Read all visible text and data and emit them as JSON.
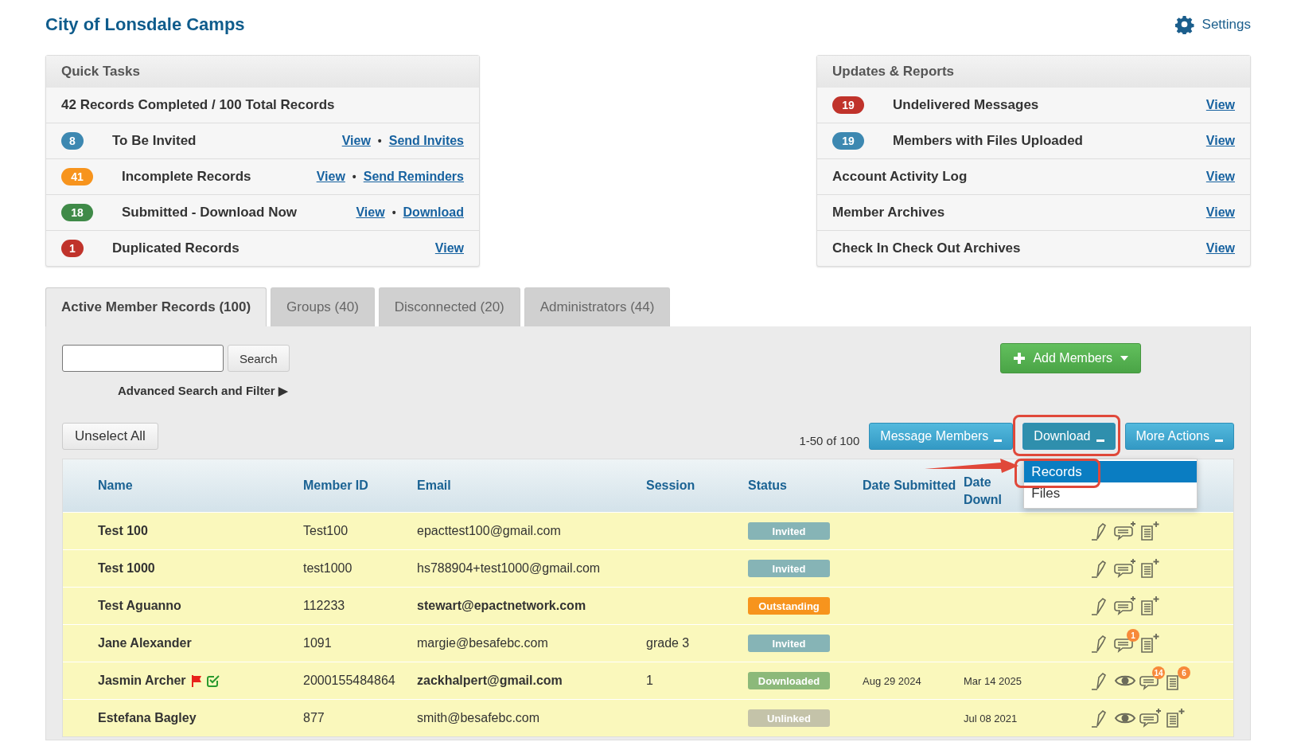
{
  "header": {
    "title": "City of Lonsdale Camps",
    "settings": "Settings"
  },
  "quick_tasks": {
    "title": "Quick Tasks",
    "separator": "•",
    "summary": "42 Records Completed / 100 Total Records",
    "rows": [
      {
        "count": "8",
        "color": "#3d88b1",
        "label": "To Be Invited",
        "links": [
          "View",
          "Send Invites"
        ]
      },
      {
        "count": "41",
        "color": "#f7941d",
        "label": "Incomplete Records",
        "links": [
          "View",
          "Send Reminders"
        ]
      },
      {
        "count": "18",
        "color": "#3f8a48",
        "label": "Submitted - Download Now",
        "links": [
          "View",
          "Download"
        ]
      },
      {
        "count": "1",
        "color": "#c0332b",
        "label": "Duplicated Records",
        "links": [
          "View"
        ]
      }
    ]
  },
  "updates": {
    "title": "Updates & Reports",
    "rows": [
      {
        "count": "19",
        "color": "#c0332b",
        "label": "Undelivered Messages",
        "link": "View"
      },
      {
        "count": "19",
        "color": "#3d88b1",
        "label": "Members with Files Uploaded",
        "link": "View"
      },
      {
        "label": "Account Activity Log",
        "link": "View"
      },
      {
        "label": "Member Archives",
        "link": "View"
      },
      {
        "label": "Check In Check Out Archives",
        "link": "View"
      }
    ]
  },
  "tabs": [
    {
      "label": "Active Member Records (100)",
      "selected": true
    },
    {
      "label": "Groups (40)",
      "selected": false
    },
    {
      "label": "Disconnected (20)",
      "selected": false
    },
    {
      "label": "Administrators (44)",
      "selected": false
    }
  ],
  "search": {
    "button": "Search",
    "advanced": "Advanced Search and Filter ▶"
  },
  "add_members": "Add Members",
  "unselect_all": "Unselect All",
  "pagination": "1-50 of 100",
  "actions": [
    {
      "label": "Message Members",
      "pressed": false
    },
    {
      "label": "Download",
      "pressed": true
    },
    {
      "label": "More Actions",
      "pressed": false
    }
  ],
  "dropdown": {
    "items": [
      {
        "label": "Records",
        "selected": true
      },
      {
        "label": "Files",
        "selected": false
      }
    ]
  },
  "table": {
    "columns": [
      "Name",
      "Member ID",
      "Email",
      "Session",
      "Status",
      "Date Submitted",
      "Date Downl"
    ],
    "rows": [
      {
        "name": "Test 100",
        "flagged": false,
        "verified": false,
        "member_id": "Test100",
        "email": "epacttest100@gmail.com",
        "email_bold": false,
        "status": "Invited",
        "color": "#86b4b6",
        "viewable": false
      },
      {
        "name": "Test 1000",
        "flagged": false,
        "verified": false,
        "member_id": "test1000",
        "email": "hs788904+test1000@gmail.com",
        "email_bold": false,
        "status": "Invited",
        "color": "#86b4b6",
        "viewable": false
      },
      {
        "name": "Test Aguanno",
        "flagged": false,
        "verified": false,
        "member_id": "112233",
        "email": "stewart@epactnetwork.com",
        "email_bold": true,
        "status": "Outstanding",
        "color": "#f7941d",
        "viewable": false
      },
      {
        "name": "Jane Alexander",
        "flagged": false,
        "verified": false,
        "member_id": "1091",
        "email": "margie@besafebc.com",
        "email_bold": false,
        "session": "grade 3",
        "status": "Invited",
        "color": "#86b4b6",
        "viewable": false,
        "message_badge": "1"
      },
      {
        "name": "Jasmin Archer",
        "flagged": true,
        "verified": true,
        "member_id": "2000155484864",
        "email": "zackhalpert@gmail.com",
        "email_bold": true,
        "session": "1",
        "status": "Downloaded",
        "color": "#8cb97a",
        "date_submitted": "Aug 29 2024",
        "date_downloaded": "Mar 14 2025",
        "viewable": true,
        "message_badge": "14",
        "file_badge": "6"
      },
      {
        "name": "Estefana Bagley",
        "flagged": false,
        "verified": false,
        "member_id": "877",
        "email": "smith@besafebc.com",
        "email_bold": false,
        "status": "Unlinked",
        "color": "#c4c3a9",
        "date_downloaded": "Jul 08 2021",
        "viewable": true
      }
    ]
  }
}
